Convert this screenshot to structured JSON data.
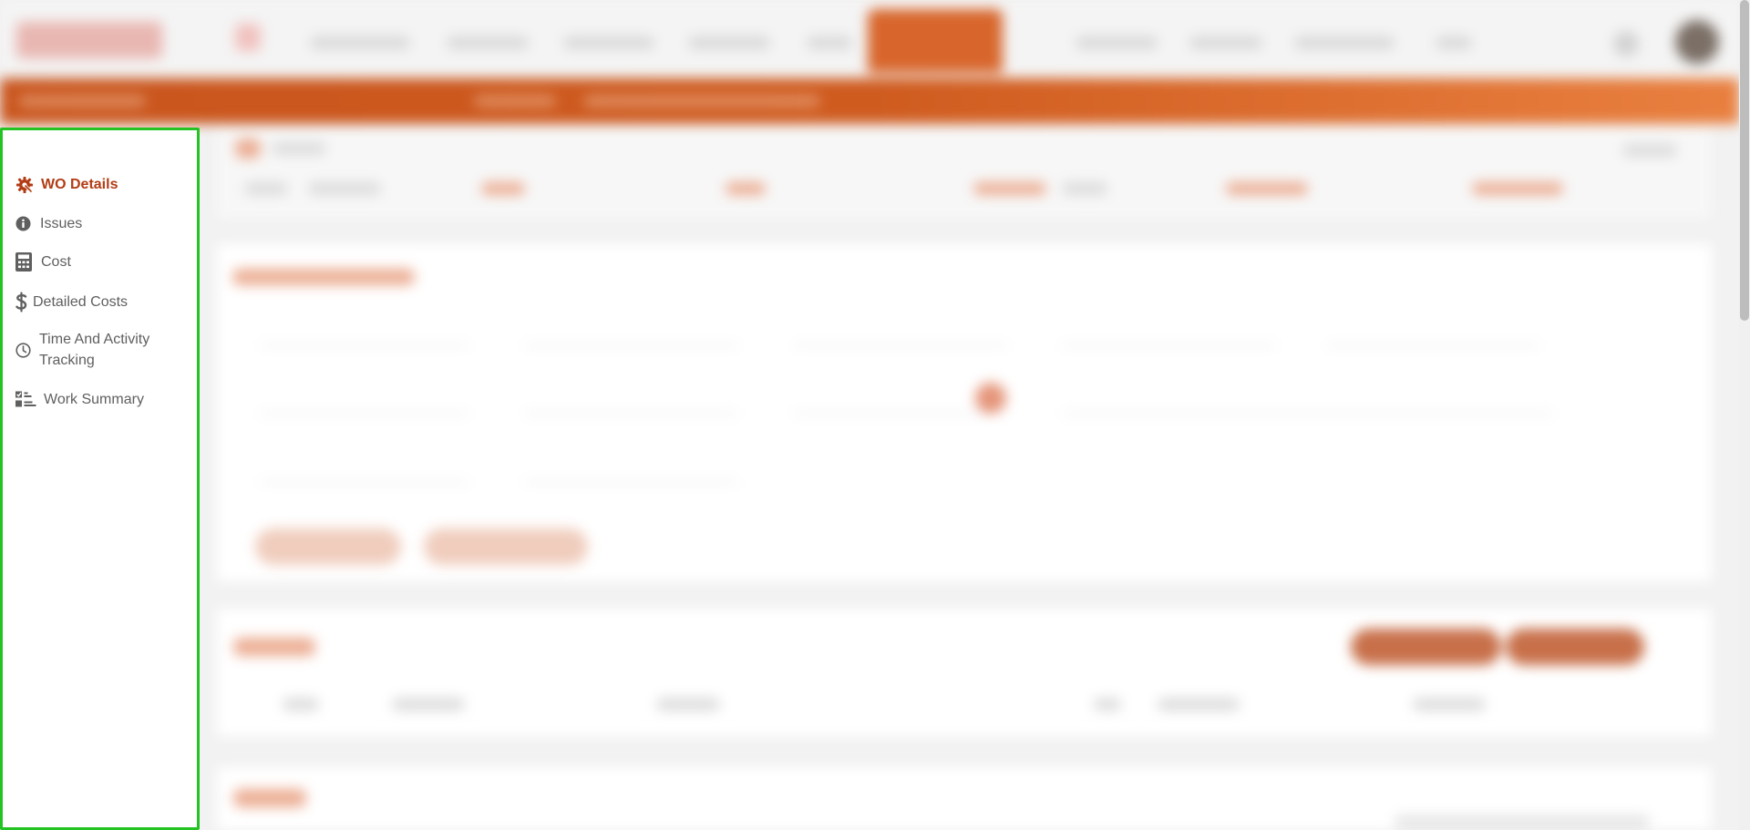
{
  "colors": {
    "accent": "#b23c14",
    "header_orange": "#cf5b1f",
    "sidebar_border": "#22c322",
    "menu_text": "#5f5f5f"
  },
  "sidebar": {
    "items": [
      {
        "label": "WO Details",
        "icon": "gear-wrench-icon",
        "active": true
      },
      {
        "label": "Issues",
        "icon": "info-icon",
        "active": false
      },
      {
        "label": "Cost",
        "icon": "calculator-icon",
        "active": false
      },
      {
        "label": "Detailed Costs",
        "icon": "dollar-icon",
        "active": false
      },
      {
        "label": "Time And Activity\nTracking",
        "icon": "clock-icon",
        "active": false
      },
      {
        "label": "Work Summary",
        "icon": "checklist-icon",
        "active": false
      }
    ]
  }
}
